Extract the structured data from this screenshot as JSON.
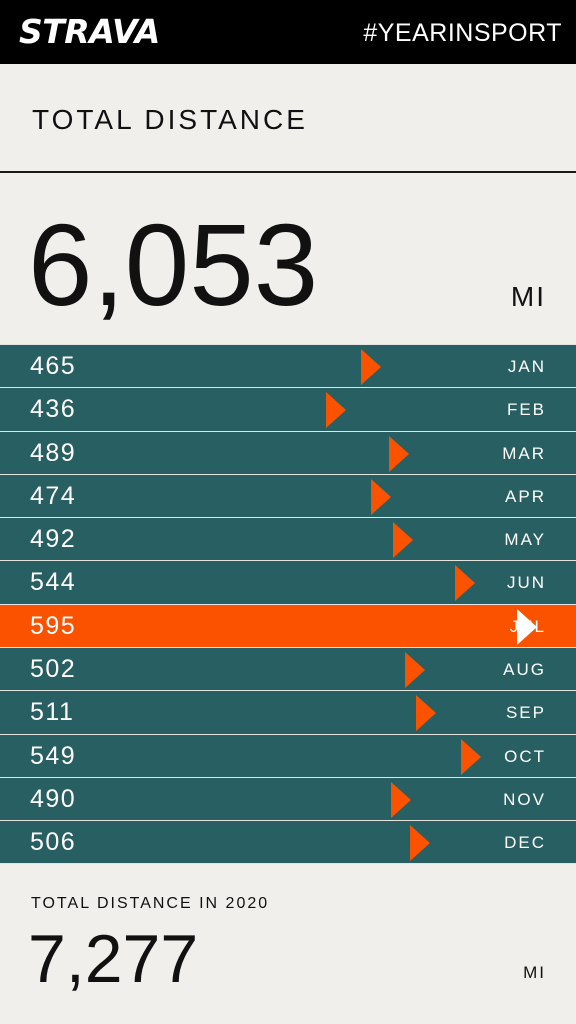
{
  "header": {
    "logo_text": "STRAVA",
    "hashtag": "#YEARINSPORT"
  },
  "colors": {
    "header_bg": "#000000",
    "page_bg": "#f1efeb",
    "row_bg": "#285f62",
    "highlight": "#fb5200",
    "marker": "#fb5200",
    "highlight_marker": "#ffffff"
  },
  "summary": {
    "title": "TOTAL DISTANCE",
    "value": "6,053",
    "unit": "MI"
  },
  "chart_data": {
    "type": "bar",
    "categories": [
      "JAN",
      "FEB",
      "MAR",
      "APR",
      "MAY",
      "JUN",
      "JUL",
      "AUG",
      "SEP",
      "OCT",
      "NOV",
      "DEC"
    ],
    "values": [
      465,
      436,
      489,
      474,
      492,
      544,
      595,
      502,
      511,
      549,
      490,
      506
    ],
    "highlight_category": "JUL",
    "title": "TOTAL DISTANCE",
    "unit": "MI"
  },
  "comparison": {
    "title": "TOTAL DISTANCE IN 2020",
    "value": "7,277",
    "unit": "MI"
  }
}
